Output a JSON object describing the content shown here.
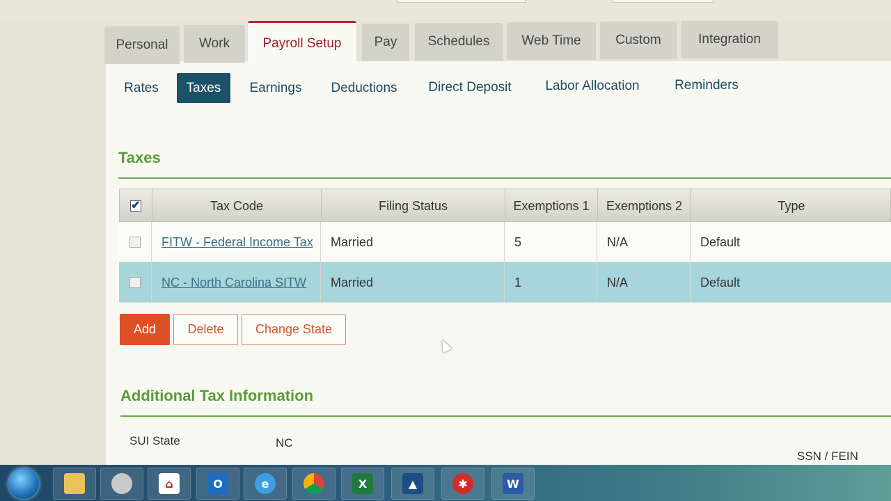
{
  "main_tabs": [
    "Personal",
    "Work",
    "Payroll Setup",
    "Pay",
    "Schedules",
    "Web Time",
    "Custom",
    "Integration"
  ],
  "active_main_tab": "Payroll Setup",
  "sub_tabs": [
    "Rates",
    "Taxes",
    "Earnings",
    "Deductions",
    "Direct Deposit",
    "Labor Allocation",
    "Reminders"
  ],
  "active_sub_tab": "Taxes",
  "taxes": {
    "title": "Taxes",
    "columns": [
      "Tax Code",
      "Filing Status",
      "Exemptions 1",
      "Exemptions 2",
      "Type"
    ],
    "rows": [
      {
        "tax_code": "FITW - Federal Income Tax",
        "filing_status": "Married",
        "exemptions1": "5",
        "exemptions2": "N/A",
        "type": "Default"
      },
      {
        "tax_code": "NC - North Carolina SITW",
        "filing_status": "Married",
        "exemptions1": "1",
        "exemptions2": "N/A",
        "type": "Default"
      }
    ]
  },
  "buttons": {
    "add": "Add",
    "delete": "Delete",
    "change_state": "Change State"
  },
  "additional": {
    "title": "Additional Tax Information",
    "sui_state_label": "SUI State",
    "sui_state_value": "NC",
    "ssn_fein_label": "SSN / FEIN"
  },
  "taskbar_icons": [
    "windows-start-icon",
    "file-explorer-icon",
    "snipping-tool-icon",
    "adobe-pdf-icon",
    "outlook-icon",
    "internet-explorer-icon",
    "chrome-icon",
    "excel-icon",
    "app-icon",
    "crm-app-icon",
    "word-icon"
  ],
  "colors": {
    "accent_tab": "#a01e2b",
    "active_subtab": "#1b5268",
    "section_title": "#5a9b3a",
    "primary_button": "#e04e24",
    "selected_row": "#a7d5dc"
  }
}
